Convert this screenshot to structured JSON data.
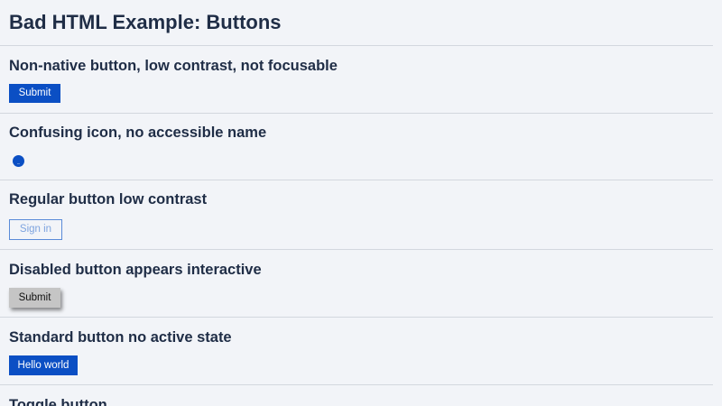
{
  "page": {
    "title": "Bad HTML Example: Buttons"
  },
  "sections": [
    {
      "heading": "Non-native button, low contrast, not focusable",
      "button_label": "Submit"
    },
    {
      "heading": "Confusing icon, no accessible name",
      "icon": "circle-icon"
    },
    {
      "heading": "Regular button low contrast",
      "button_label": "Sign in"
    },
    {
      "heading": "Disabled button appears interactive",
      "button_label": "Submit"
    },
    {
      "heading": "Standard button no active state",
      "button_label": "Hello world"
    },
    {
      "heading": "Toggle button"
    }
  ],
  "colors": {
    "background": "#f2f4f8",
    "text": "#1f2d46",
    "primary_button": "#0b4fc4",
    "outline_border": "#5a8bd8",
    "outline_text": "#7ea4df",
    "disabled_button": "#c5c5c5",
    "divider": "#d3d7de"
  }
}
